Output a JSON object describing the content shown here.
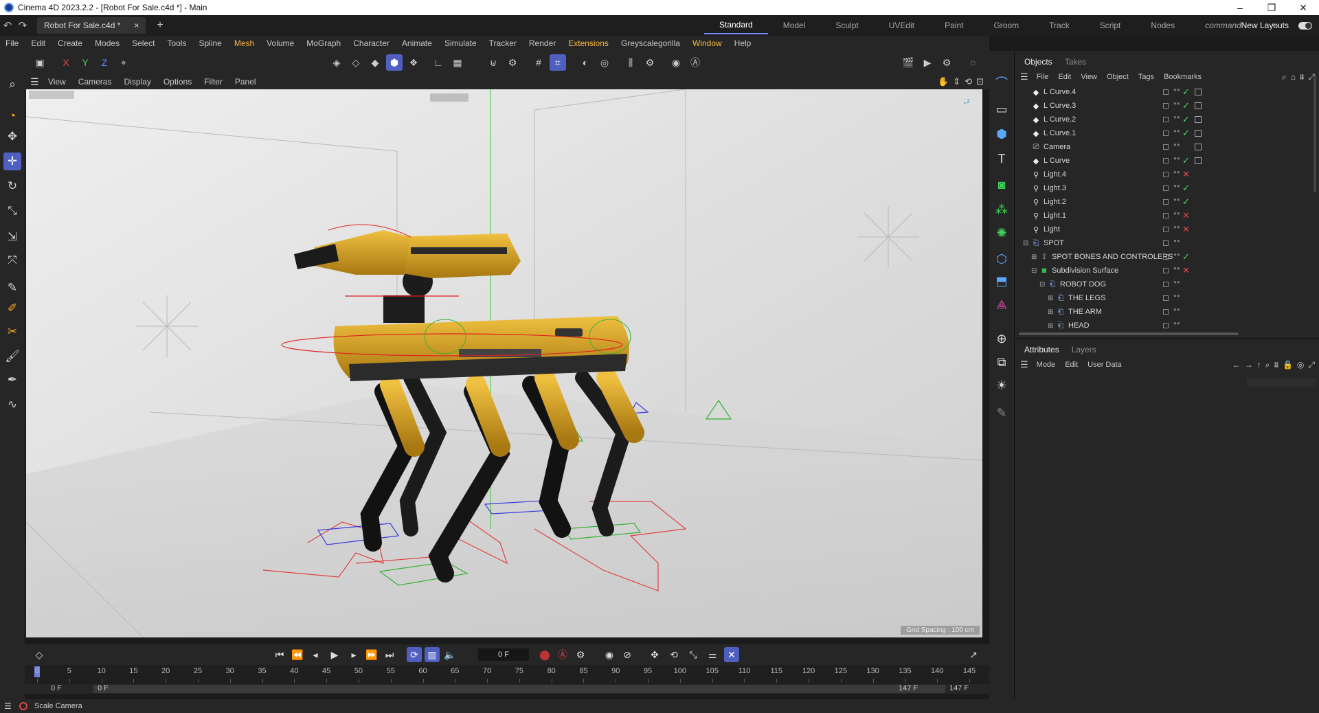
{
  "window": {
    "title": "Cinema 4D 2023.2.2 - [Robot For Sale.c4d *] - Main"
  },
  "tabs": {
    "doc_tab": "Robot For Sale.c4d *",
    "close": "×",
    "add": "+"
  },
  "layouts": {
    "items": [
      "Standard",
      "Model",
      "Sculpt",
      "UVEdit",
      "Paint",
      "Groom",
      "Track",
      "Script",
      "Nodes",
      "command"
    ],
    "active": "Standard",
    "new_layouts": "New Layouts"
  },
  "menubar": {
    "items": [
      "File",
      "Edit",
      "Create",
      "Modes",
      "Select",
      "Tools",
      "Spline",
      "Mesh",
      "Volume",
      "MoGraph",
      "Character",
      "Animate",
      "Simulate",
      "Tracker",
      "Render",
      "Extensions",
      "Greyscalegorilla",
      "Window",
      "Help"
    ]
  },
  "viewport": {
    "menu": [
      "View",
      "Cameras",
      "Display",
      "Options",
      "Filter",
      "Panel"
    ],
    "grid_spacing": "Grid Spacing : 100 cm"
  },
  "timeline": {
    "current_frame": "0 F",
    "ticks": [
      "0",
      "5",
      "10",
      "15",
      "20",
      "25",
      "30",
      "35",
      "40",
      "45",
      "50",
      "55",
      "60",
      "65",
      "70",
      "75",
      "80",
      "85",
      "90",
      "95",
      "100",
      "105",
      "110",
      "115",
      "120",
      "125",
      "130",
      "135",
      "140",
      "145"
    ],
    "range_start": "0 F",
    "range_start2": "0 F",
    "range_end": "147 F",
    "range_end2": "147 F"
  },
  "status": {
    "text": "Scale Camera"
  },
  "objects_panel": {
    "tabs": [
      "Objects",
      "Takes"
    ],
    "menu": [
      "File",
      "Edit",
      "View",
      "Object",
      "Tags",
      "Bookmarks"
    ],
    "rows": [
      {
        "name": "L Curve.4",
        "indent": 0,
        "icon": "spline-icon",
        "status": "check",
        "tag": true
      },
      {
        "name": "L Curve.3",
        "indent": 0,
        "icon": "spline-icon",
        "status": "check",
        "tag": true
      },
      {
        "name": "L Curve.2",
        "indent": 0,
        "icon": "spline-icon",
        "status": "check",
        "tag": true
      },
      {
        "name": "L Curve.1",
        "indent": 0,
        "icon": "spline-icon",
        "status": "check",
        "tag": true
      },
      {
        "name": "Camera",
        "indent": 0,
        "icon": "camera-icon",
        "status": "",
        "tag": true
      },
      {
        "name": "L Curve",
        "indent": 0,
        "icon": "spline-icon",
        "status": "check",
        "tag": true
      },
      {
        "name": "Light.4",
        "indent": 0,
        "icon": "light-icon",
        "status": "cross",
        "tag": false
      },
      {
        "name": "Light.3",
        "indent": 0,
        "icon": "light-icon",
        "status": "check",
        "tag": false
      },
      {
        "name": "Light.2",
        "indent": 0,
        "icon": "light-icon",
        "status": "check",
        "tag": false
      },
      {
        "name": "Light.1",
        "indent": 0,
        "icon": "light-icon",
        "status": "cross",
        "tag": false
      },
      {
        "name": "Light",
        "indent": 0,
        "icon": "light-icon",
        "status": "cross",
        "tag": false
      },
      {
        "name": "SPOT",
        "indent": 0,
        "icon": "null-icon",
        "status": "",
        "tag": false
      },
      {
        "name": "SPOT BONES AND CONTROLERS",
        "indent": 1,
        "icon": "bones-icon",
        "status": "check",
        "tag": false
      },
      {
        "name": "Subdivision Surface",
        "indent": 1,
        "icon": "subdivision-icon",
        "status": "cross",
        "tag": false
      },
      {
        "name": "ROBOT DOG",
        "indent": 2,
        "icon": "null-icon",
        "status": "",
        "tag": false
      },
      {
        "name": "THE LEGS",
        "indent": 3,
        "icon": "null-icon",
        "status": "",
        "tag": false
      },
      {
        "name": "THE ARM",
        "indent": 3,
        "icon": "null-icon",
        "status": "",
        "tag": false
      },
      {
        "name": "HEAD",
        "indent": 3,
        "icon": "null-icon",
        "status": "",
        "tag": false
      }
    ]
  },
  "attributes_panel": {
    "tabs": [
      "Attributes",
      "Layers"
    ],
    "menu": [
      "Mode",
      "Edit",
      "User Data"
    ]
  },
  "colors": {
    "accent": "#4f5fc0",
    "highlight_menu": "#ffb840",
    "check": "#4edc6a",
    "cross": "#e04848",
    "robot_yellow": "#d9a322"
  }
}
